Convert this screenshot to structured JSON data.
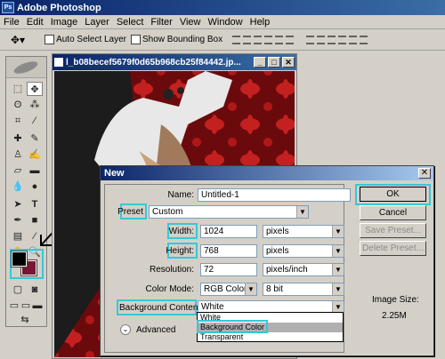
{
  "app": {
    "title": "Adobe Photoshop"
  },
  "menu": [
    "File",
    "Edit",
    "Image",
    "Layer",
    "Select",
    "Filter",
    "View",
    "Window",
    "Help"
  ],
  "options": {
    "auto_select": "Auto Select Layer",
    "bounding_box": "Show Bounding Box"
  },
  "document": {
    "title": "l_b08becef5679f0d65b968cb25f84442.jp..."
  },
  "dialog": {
    "title": "New",
    "name_label": "Name:",
    "name_value": "Untitled-1",
    "preset_label": "Preset",
    "preset_value": "Custom",
    "width_label": "Width:",
    "width_value": "1024",
    "width_unit": "pixels",
    "height_label": "Height:",
    "height_value": "768",
    "height_unit": "pixels",
    "resolution_label": "Resolution:",
    "resolution_value": "72",
    "resolution_unit": "pixels/inch",
    "colormode_label": "Color Mode:",
    "colormode_value": "RGB Color",
    "bitdepth_value": "8 bit",
    "bgcontents_label": "Background Contents:",
    "bgcontents_value": "White",
    "bg_options": [
      "White",
      "Background Color",
      "Transparent"
    ],
    "advanced_label": "Advanced",
    "ok_label": "OK",
    "cancel_label": "Cancel",
    "save_preset_label": "Save Preset...",
    "delete_preset_label": "Delete Preset...",
    "image_size_label": "Image Size:",
    "image_size_value": "2.25M"
  },
  "colors": {
    "foreground": "#000000",
    "background": "#7a1633",
    "highlight": "#35c8d8"
  }
}
